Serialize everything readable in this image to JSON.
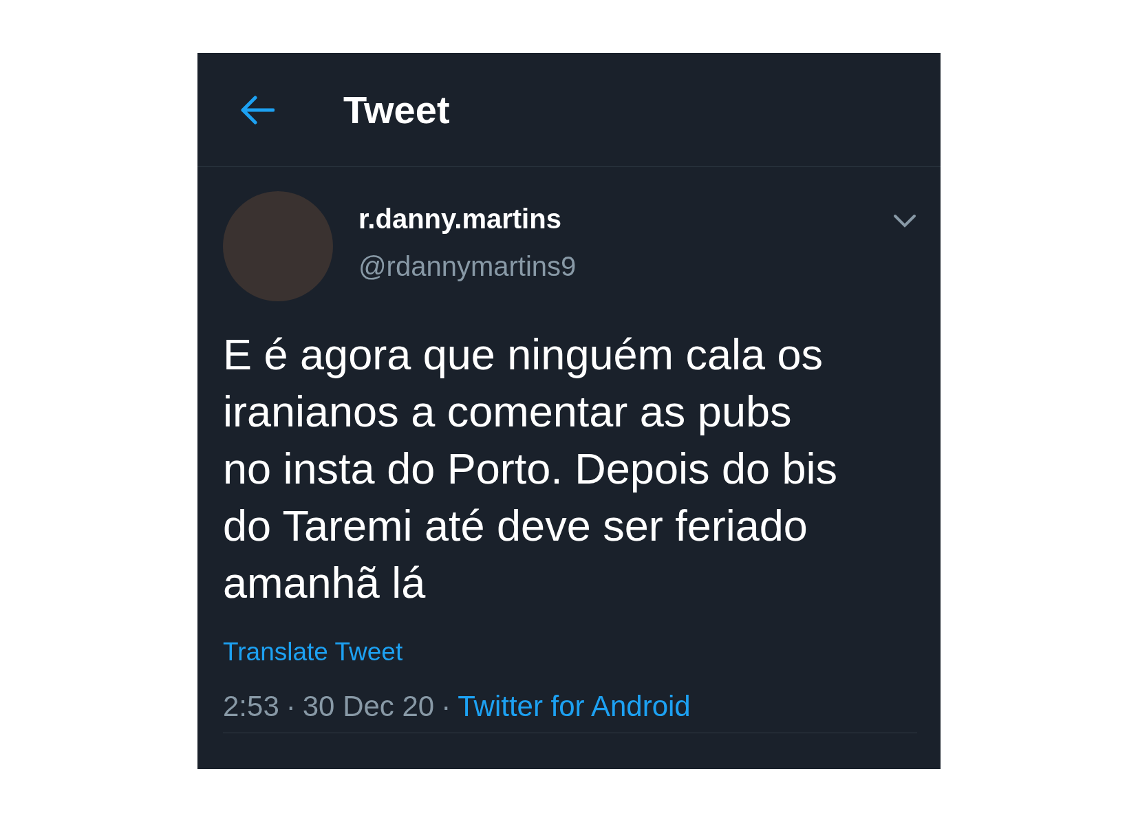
{
  "header": {
    "title": "Tweet"
  },
  "tweet": {
    "name": "r.danny.martins",
    "handle": "@rdannymartins9",
    "text": "E é agora que ninguém cala os iranianos a comentar as pubs no insta do Porto. Depois do bis do Taremi até deve ser feriado amanhã lá",
    "translate": "Translate Tweet",
    "time": "2:53",
    "separator_1": "·",
    "date": "30 Dec 20",
    "separator_2": "·",
    "source": "Twitter for Android"
  }
}
